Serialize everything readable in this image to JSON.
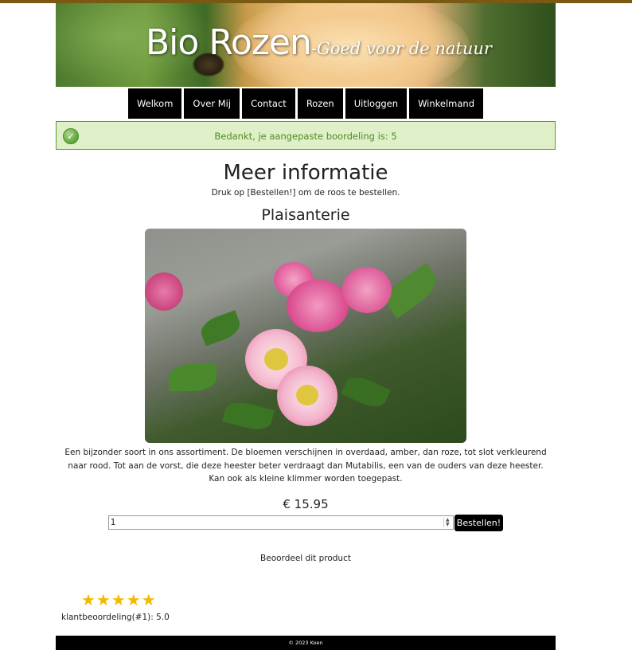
{
  "header": {
    "site_title": "Bio Rozen",
    "tagline": "-Goed voor de natuur"
  },
  "nav": {
    "items": [
      "Welkom",
      "Over Mij",
      "Contact",
      "Rozen",
      "Uitloggen",
      "Winkelmand"
    ]
  },
  "message": {
    "text": "Bedankt, je aangepaste boordeling is: 5"
  },
  "main": {
    "title": "Meer informatie",
    "instruction": "Druk op [Bestellen!] om de roos te bestellen.",
    "product_name": "Plaisanterie",
    "image_icon": "rose-photo",
    "description": "Een bijzonder soort in ons assortiment. De bloemen verschijnen in overdaad, amber, dan roze, tot slot verkleurend naar rood. Tot aan de vorst, die deze heester beter verdraagt dan Mutabilis, een van de ouders van deze heester. Kan ook als kleine klimmer worden toegepast.",
    "price": "€ 15.95",
    "quantity_value": "1",
    "order_button": "Bestellen!",
    "rate_label": "Beoordeel dit product",
    "stars": "★★★★★",
    "star_count": 5,
    "rating_text": "klantbeoordeling(#1): 5.0"
  },
  "footer": {
    "text": "© 2023 Koen"
  },
  "colors": {
    "nav_bg": "#000000",
    "success_bg": "#dff0c8",
    "success_border": "#5e9a2e",
    "success_text": "#4d8a24",
    "star": "#f5b800"
  }
}
